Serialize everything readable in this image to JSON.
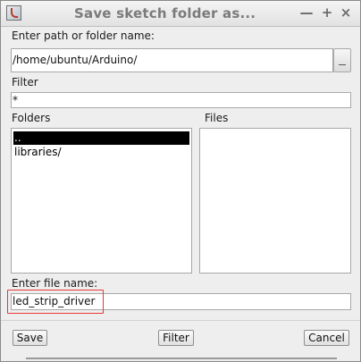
{
  "window": {
    "title": "Save sketch folder as...",
    "icon": "java-app-icon",
    "controls": {
      "minimize": "—",
      "maximize": "+",
      "close": "×"
    }
  },
  "path": {
    "label": "Enter path or folder name:",
    "value": "/home/ubuntu/Arduino/"
  },
  "filter": {
    "label": "Filter",
    "value": "*"
  },
  "folders": {
    "label": "Folders",
    "items": [
      "..",
      "libraries/"
    ],
    "selected_index": 0
  },
  "files": {
    "label": "Files",
    "items": []
  },
  "filename": {
    "label": "Enter file name:",
    "value": "led_strip_driver"
  },
  "buttons": {
    "save": "Save",
    "filter": "Filter",
    "cancel": "Cancel"
  },
  "colors": {
    "highlight_box": "#e53935",
    "selection_bg": "#000000"
  }
}
